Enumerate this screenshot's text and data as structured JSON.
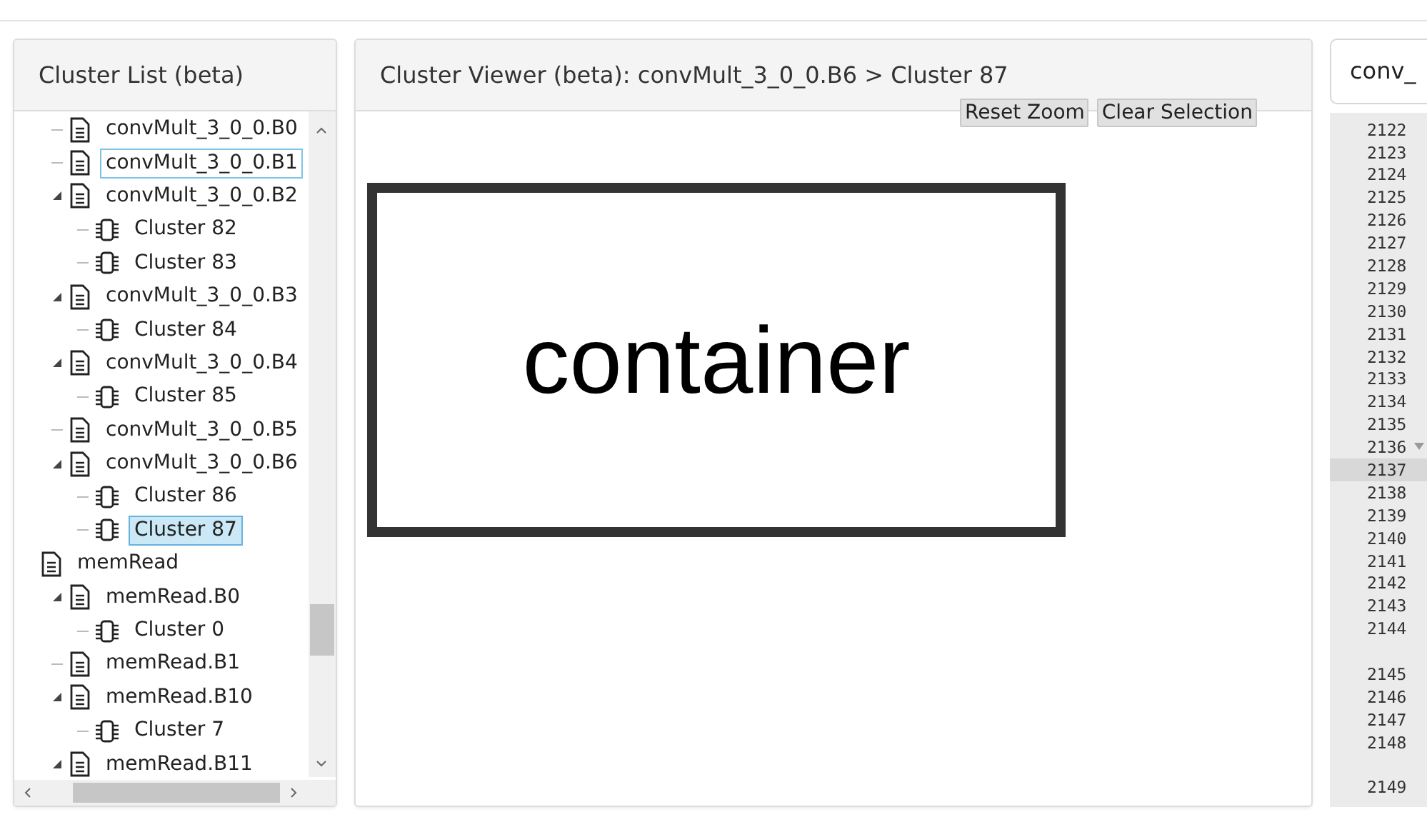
{
  "cluster_list": {
    "title": "Cluster List (beta)",
    "continued_children": [
      {
        "label": "convMult_3_0_0.B0",
        "kind": "block",
        "selected": false,
        "focused": false
      },
      {
        "label": "convMult_3_0_0.B1",
        "kind": "block",
        "selected": false,
        "focused": true
      },
      {
        "label": "convMult_3_0_0.B2",
        "kind": "block",
        "selected": false,
        "focused": false,
        "expanded": true,
        "children": [
          {
            "label": "Cluster 82",
            "kind": "cluster",
            "selected": false,
            "focused": false
          },
          {
            "label": "Cluster 83",
            "kind": "cluster",
            "selected": false,
            "focused": false
          }
        ]
      },
      {
        "label": "convMult_3_0_0.B3",
        "kind": "block",
        "selected": false,
        "focused": false,
        "expanded": true,
        "children": [
          {
            "label": "Cluster 84",
            "kind": "cluster",
            "selected": false,
            "focused": false
          }
        ]
      },
      {
        "label": "convMult_3_0_0.B4",
        "kind": "block",
        "selected": false,
        "focused": false,
        "expanded": true,
        "children": [
          {
            "label": "Cluster 85",
            "kind": "cluster",
            "selected": false,
            "focused": false
          }
        ]
      },
      {
        "label": "convMult_3_0_0.B5",
        "kind": "block",
        "selected": false,
        "focused": false
      },
      {
        "label": "convMult_3_0_0.B6",
        "kind": "block",
        "selected": false,
        "focused": false,
        "expanded": true,
        "children": [
          {
            "label": "Cluster 86",
            "kind": "cluster",
            "selected": false,
            "focused": false
          },
          {
            "label": "Cluster 87",
            "kind": "cluster",
            "selected": true,
            "focused": false
          }
        ]
      }
    ],
    "items": [
      {
        "label": "memRead",
        "kind": "block",
        "selected": false,
        "focused": false,
        "children": [
          {
            "label": "memRead.B0",
            "kind": "block",
            "selected": false,
            "focused": false,
            "expanded": true,
            "children": [
              {
                "label": "Cluster 0",
                "kind": "cluster",
                "selected": false,
                "focused": false
              }
            ]
          },
          {
            "label": "memRead.B1",
            "kind": "block",
            "selected": false,
            "focused": false
          },
          {
            "label": "memRead.B10",
            "kind": "block",
            "selected": false,
            "focused": false,
            "expanded": true,
            "children": [
              {
                "label": "Cluster 7",
                "kind": "cluster",
                "selected": false,
                "focused": false
              }
            ]
          },
          {
            "label": "memRead.B11",
            "kind": "block",
            "selected": false,
            "focused": false,
            "expanded": true
          }
        ]
      }
    ]
  },
  "cluster_viewer": {
    "title": "Cluster Viewer (beta): convMult_3_0_0.B6 > Cluster 87",
    "buttons": [
      "Reset Zoom",
      "Clear Selection"
    ],
    "node": {
      "label": "container"
    }
  },
  "source_view": {
    "tab": "conv_",
    "lines": [
      {
        "kind": "line",
        "number": "2122",
        "selected": false
      },
      {
        "kind": "line",
        "number": "2123",
        "selected": false
      },
      {
        "kind": "line",
        "number": "2124",
        "selected": false
      },
      {
        "kind": "line",
        "number": "2125",
        "selected": false
      },
      {
        "kind": "line",
        "number": "2126",
        "selected": false
      },
      {
        "kind": "line",
        "number": "2127",
        "selected": false
      },
      {
        "kind": "line",
        "number": "2128",
        "selected": false
      },
      {
        "kind": "line",
        "number": "2129",
        "selected": false
      },
      {
        "kind": "line",
        "number": "2130",
        "selected": false
      },
      {
        "kind": "line",
        "number": "2131",
        "selected": false
      },
      {
        "kind": "line",
        "number": "2132",
        "selected": false
      },
      {
        "kind": "line",
        "number": "2133",
        "selected": false
      },
      {
        "kind": "line",
        "number": "2134",
        "selected": false
      },
      {
        "kind": "line",
        "number": "2135",
        "selected": false
      },
      {
        "kind": "fold",
        "number": "2136",
        "selected": false
      },
      {
        "kind": "line",
        "number": "2137",
        "selected": true
      },
      {
        "kind": "line",
        "number": "2138",
        "selected": false
      },
      {
        "kind": "line",
        "number": "2139",
        "selected": false
      },
      {
        "kind": "line",
        "number": "2140",
        "selected": false
      },
      {
        "kind": "line",
        "number": "2141",
        "selected": false
      },
      {
        "kind": "line",
        "number": "2142",
        "selected": false
      },
      {
        "kind": "line",
        "number": "2143",
        "selected": false
      },
      {
        "kind": "line",
        "number": "2144",
        "selected": false
      },
      {
        "kind": "wrap",
        "selected": false
      },
      {
        "kind": "line",
        "number": "2145",
        "selected": false
      },
      {
        "kind": "line",
        "number": "2146",
        "selected": false
      },
      {
        "kind": "line",
        "number": "2147",
        "selected": false
      },
      {
        "kind": "line",
        "number": "2148",
        "selected": false
      },
      {
        "kind": "wrap",
        "selected": false
      },
      {
        "kind": "line",
        "number": "2149",
        "selected": false
      }
    ]
  }
}
